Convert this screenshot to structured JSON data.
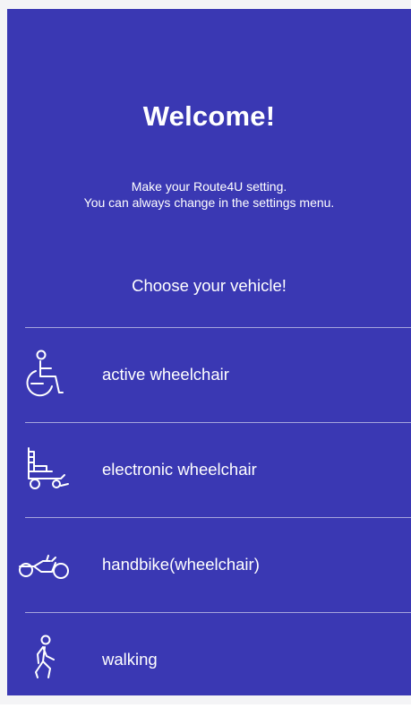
{
  "welcome": {
    "title": "Welcome!",
    "line1": "Make your Route4U setting.",
    "line2": "You can always change in the settings menu."
  },
  "vehicle": {
    "heading": "Choose your vehicle!",
    "options": [
      {
        "label": "active wheelchair",
        "icon": "active-wheelchair-icon"
      },
      {
        "label": "electronic wheelchair",
        "icon": "electric-wheelchair-icon"
      },
      {
        "label": "handbike(wheelchair)",
        "icon": "handbike-icon"
      },
      {
        "label": "walking",
        "icon": "walking-icon"
      }
    ]
  },
  "colors": {
    "background": "#3a38b3",
    "text": "#ffffff"
  }
}
